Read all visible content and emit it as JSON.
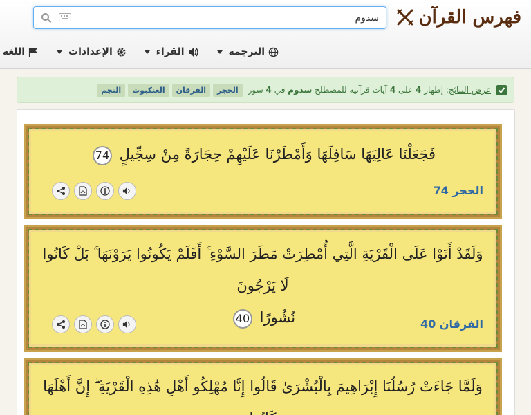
{
  "brand": {
    "title": "فهرس القرآن"
  },
  "search": {
    "value": "سدوم",
    "placeholder": ""
  },
  "menu": {
    "translation": "الترجمة",
    "reciter": "القراء",
    "settings": "الإعدادات",
    "language": "اللغة"
  },
  "results": {
    "prefix_u": "عرض النتائج",
    "text_1": ": إظهار",
    "shown": "4",
    "text_2": "على",
    "total": "4",
    "text_3": "آيات قرآنية للمصطلح",
    "term": "سدوم",
    "text_4": "في",
    "suras": "4",
    "text_5": "سور",
    "tags": [
      "الحجر",
      "الفرقان",
      "العنكبوت",
      "النجم"
    ]
  },
  "verses": [
    {
      "text": "فَجَعَلْنَا عَالِيَهَا سَافِلَهَا وَأَمْطَرْنَا عَلَيْهِمْ حِجَارَةً مِنْ سِجِّيلٍ",
      "number": "74",
      "sura": "الحجر",
      "ayah": "74"
    },
    {
      "text_line1": "وَلَقَدْ أَتَوْا عَلَى الْقَرْيَةِ الَّتِي أُمْطِرَتْ مَطَرَ السَّوْءِ ۚ أَفَلَمْ يَكُونُوا يَرَوْنَهَا ۚ بَلْ كَانُوا لَا يَرْجُونَ",
      "text_line2": "نُشُورًا",
      "number": "40",
      "sura": "الفرقان",
      "ayah": "40"
    },
    {
      "text_line1": "وَلَمَّا جَاءَتْ رُسُلُنَا إِبْرَاهِيمَ بِالْبُشْرَىٰ قَالُوا إِنَّا مُهْلِكُو أَهْلِ هَٰذِهِ الْقَرْيَةِ ۖ إِنَّ أَهْلَهَا كَانُوا"
    }
  ],
  "icons": {
    "brand": "crossed-swords-icon",
    "search": "search-icon",
    "keyboard": "keyboard-icon",
    "translation": "globe-icon",
    "reciter": "speaker-icon",
    "settings": "gear-icon",
    "language": "flag-icon",
    "tools": [
      "share-icon",
      "pdf-icon",
      "info-icon",
      "audio-icon"
    ]
  },
  "colors": {
    "brand": "#5a2d10",
    "card_bg": "#f6e67e",
    "ref": "#2f6aa6",
    "alert_bg": "#dff0d8"
  }
}
